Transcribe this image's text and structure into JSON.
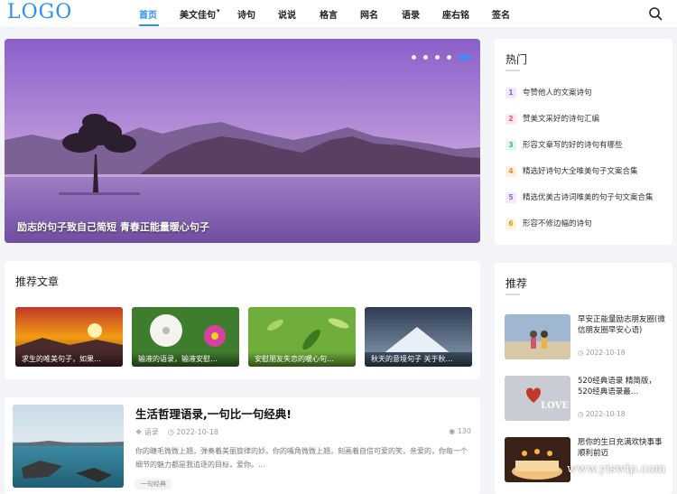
{
  "header": {
    "logo": "LOGO",
    "nav": [
      {
        "label": "首页",
        "active": true
      },
      {
        "label": "美文佳句",
        "has_caret": true
      },
      {
        "label": "诗句"
      },
      {
        "label": "说说"
      },
      {
        "label": "格言"
      },
      {
        "label": "网名"
      },
      {
        "label": "语录"
      },
      {
        "label": "座右铭"
      },
      {
        "label": "签名"
      }
    ],
    "search_icon": "search-icon"
  },
  "slider": {
    "caption": "励志的句子致自己简短 青春正能量暖心句子",
    "dot_count": 5,
    "active_dot": 4
  },
  "hot": {
    "title": "热门",
    "items": [
      {
        "num": "1",
        "text": "夸赞他人的文案诗句",
        "color": "#7a5af8",
        "bg": "#efeafe"
      },
      {
        "num": "2",
        "text": "赞美文采好的诗句汇编",
        "color": "#f0506e",
        "bg": "#fde9ed"
      },
      {
        "num": "3",
        "text": "形容文章写的好的诗句有哪些",
        "color": "#3cb371",
        "bg": "#e6f6ed"
      },
      {
        "num": "4",
        "text": "精选好诗句大全唯美句子文案合集",
        "color": "#f08a24",
        "bg": "#fdf0e3"
      },
      {
        "num": "5",
        "text": "精选优美古诗词唯美的句子句文案合集",
        "color": "#a35cf0",
        "bg": "#f3e9fd"
      },
      {
        "num": "6",
        "text": "形容不修边幅的诗句",
        "color": "#d4a017",
        "bg": "#fbf4dc"
      }
    ]
  },
  "recommended": {
    "title": "推荐文章",
    "items": [
      {
        "caption": "求生的唯美句子，如果…"
      },
      {
        "caption": "输液的语录，输液安慰…"
      },
      {
        "caption": "安慰朋友失恋的暖心句…"
      },
      {
        "caption": "秋天的意境句子 关于秋…"
      }
    ]
  },
  "post": {
    "title": "生活哲理语录,一句比一句经典!",
    "category": "语录",
    "date": "2022-10-18",
    "views": "130",
    "excerpt": "你的睫毛微微上翘，弹奏着美丽旋律的妙。你的嘴角微微上翘，刻画着自信可爱的笑，亲爱的，你每一个细节的魅力都是我追逐的目标，爱你。...",
    "tag": "一句经典"
  },
  "side_recommend": {
    "title": "推荐",
    "items": [
      {
        "title": "早安正能量励志朋友圈(微信朋友圈早安心语)",
        "date": "2022-10-18"
      },
      {
        "title": "520经典语录 精简版，520经典语录最…",
        "date": "2022-10-18"
      },
      {
        "title": "愿你的生日充满欢快事事顺利前迈",
        "date": ""
      }
    ]
  },
  "watermark": "www.yiswip.com",
  "colors": {
    "accent": "#2a8ff7"
  }
}
